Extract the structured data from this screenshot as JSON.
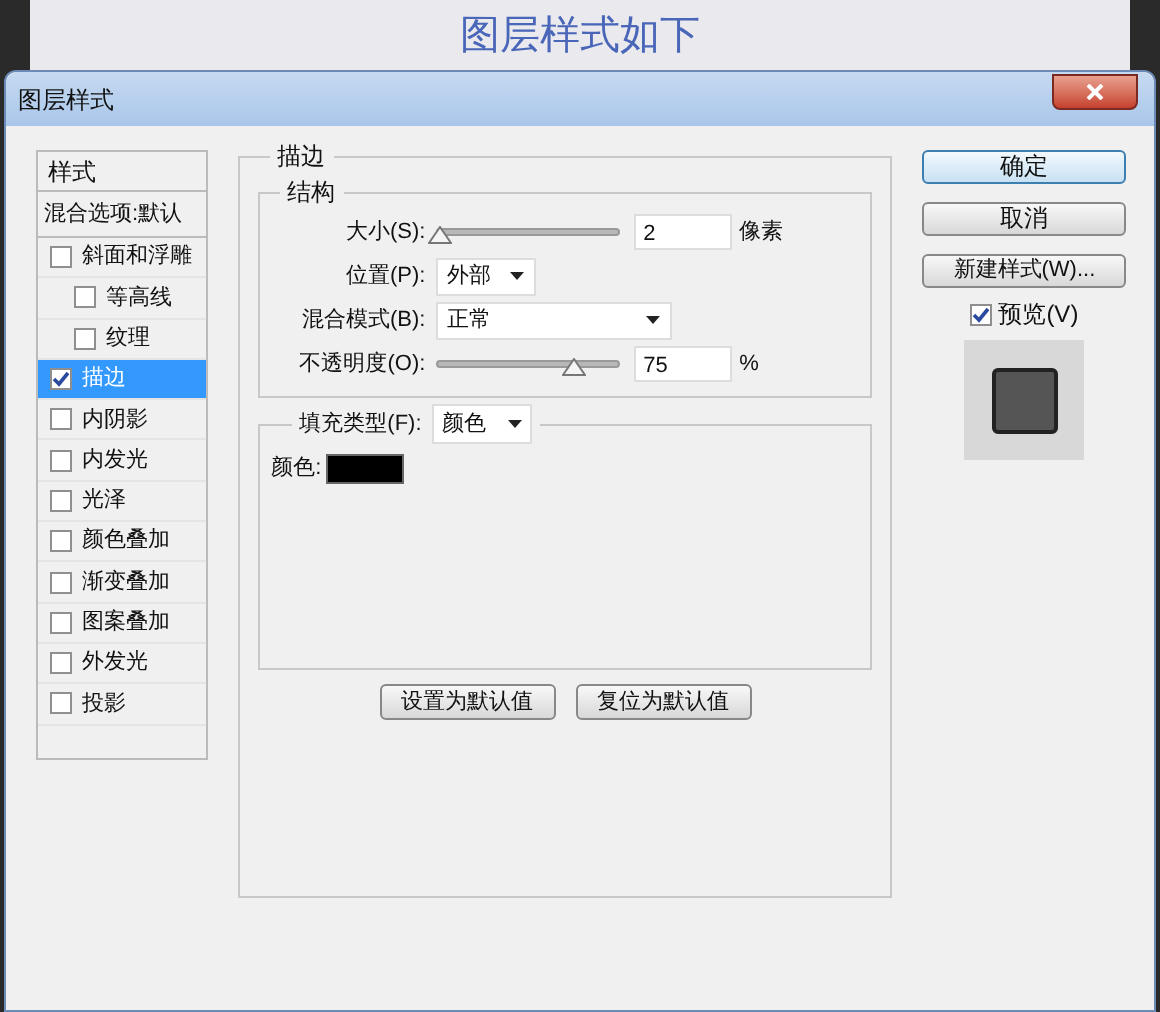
{
  "page_heading": "图层样式如下",
  "window": {
    "title": "图层样式"
  },
  "styles_list": {
    "header": "样式",
    "blending_options": "混合选项:默认",
    "items": [
      {
        "label": "斜面和浮雕",
        "checked": false,
        "selected": false,
        "children": [
          {
            "label": "等高线",
            "checked": false,
            "selected": false
          },
          {
            "label": "纹理",
            "checked": false,
            "selected": false
          }
        ]
      },
      {
        "label": "描边",
        "checked": true,
        "selected": true
      },
      {
        "label": "内阴影",
        "checked": false,
        "selected": false
      },
      {
        "label": "内发光",
        "checked": false,
        "selected": false
      },
      {
        "label": "光泽",
        "checked": false,
        "selected": false
      },
      {
        "label": "颜色叠加",
        "checked": false,
        "selected": false
      },
      {
        "label": "渐变叠加",
        "checked": false,
        "selected": false
      },
      {
        "label": "图案叠加",
        "checked": false,
        "selected": false
      },
      {
        "label": "外发光",
        "checked": false,
        "selected": false
      },
      {
        "label": "投影",
        "checked": false,
        "selected": false
      }
    ]
  },
  "stroke": {
    "title": "描边",
    "structure": {
      "title": "结构",
      "fields": [
        {
          "kind": "slider",
          "label": "大小(S):",
          "level": 0.02,
          "value": "2",
          "unit": "像素"
        },
        {
          "kind": "dropdown",
          "label": "位置(P):",
          "value": "外部"
        },
        {
          "kind": "wide_dropdown",
          "label": "混合模式(B):",
          "value": "正常"
        },
        {
          "kind": "slider",
          "label": "不透明度(O):",
          "level": 0.75,
          "value": "75",
          "unit": "%"
        }
      ]
    },
    "fill": {
      "type_label": "填充类型(F):",
      "type_value": "颜色",
      "color_label": "颜色:",
      "color": "#000000"
    },
    "buttons": [
      "设置为默认值",
      "复位为默认值"
    ]
  },
  "actions": {
    "ok": "确定",
    "cancel": "取消",
    "new_style": "新建样式(W)...",
    "preview": {
      "label": "预览(V)",
      "checked": true
    }
  }
}
